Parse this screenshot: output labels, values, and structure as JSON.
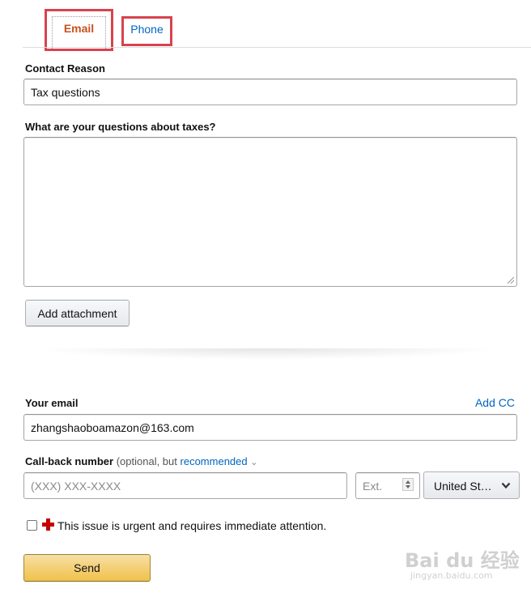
{
  "tabs": {
    "email_label": "Email",
    "phone_label": "Phone"
  },
  "contact_reason": {
    "label": "Contact Reason",
    "value": "Tax questions"
  },
  "questions": {
    "label": "What are your questions about taxes?",
    "value": ""
  },
  "attachment": {
    "button_label": "Add attachment"
  },
  "email": {
    "label": "Your email",
    "add_cc": "Add CC",
    "value": "zhangshaoboamazon@163.com"
  },
  "callback": {
    "label": "Call-back number",
    "optional_text": "(optional, but",
    "recommended_link": "recommended",
    "chevron": "⌄",
    "phone_placeholder": "(XXX) XXX-XXXX",
    "ext_placeholder": "Ext.",
    "country_value": "United St…"
  },
  "urgent": {
    "text": "This issue is urgent and requires immediate attention.",
    "checked": false
  },
  "send": {
    "label": "Send"
  },
  "watermark": {
    "brand": "Bai  du 经验",
    "url": "jingyan.baidu.com"
  },
  "colors": {
    "accent_orange": "#c7511f",
    "link_blue": "#0066c0",
    "highlight_red": "#d8434e",
    "primary_button": "#f0c14b",
    "urgent_cross": "#c40000"
  }
}
